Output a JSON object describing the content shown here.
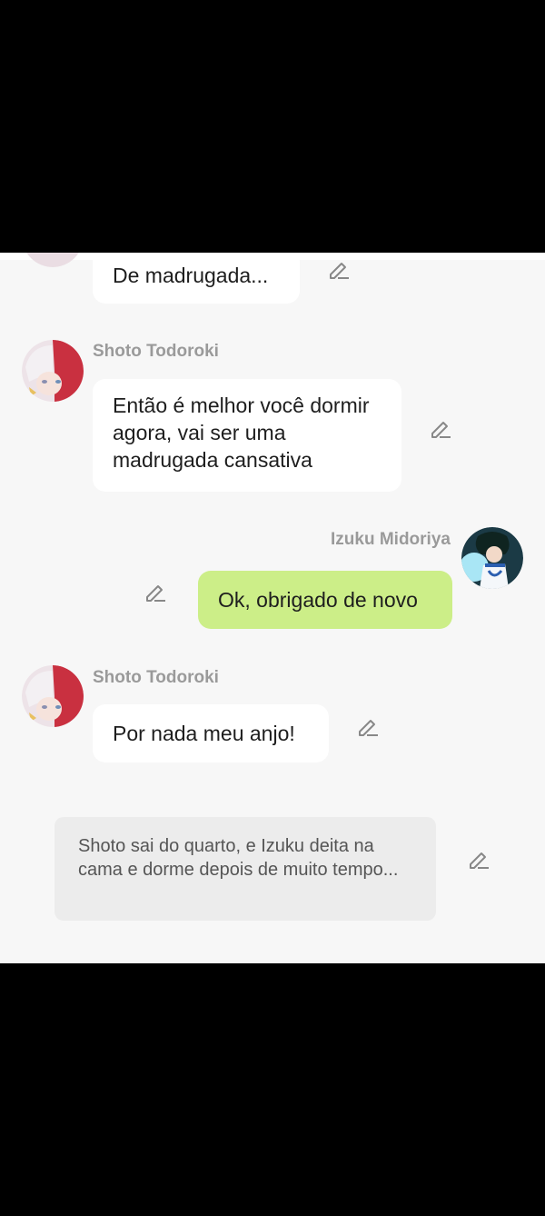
{
  "messages": [
    {
      "sender": "",
      "text": "De madrugada..."
    },
    {
      "sender": "Shoto Todoroki",
      "text": "Então é melhor você dormir agora, vai ser uma madrugada cansativa"
    },
    {
      "sender": "Izuku Midoriya",
      "text": "Ok, obrigado de novo"
    },
    {
      "sender": "Shoto Todoroki",
      "text": "Por nada meu anjo!"
    }
  ],
  "narration": {
    "text": "Shoto sai do quarto, e Izuku deita na cama e dorme depois de muito tempo..."
  },
  "icons": {
    "edit": "pencil-edit-icon",
    "avatar_shoto": "shoto-todoroki-avatar",
    "avatar_izuku": "izuku-midoriya-avatar"
  },
  "colors": {
    "chat_background": "#f7f7f7",
    "incoming_bubble": "#ffffff",
    "outgoing_bubble": "#ccee88",
    "narration_bubble": "#ececec",
    "sender_name": "#9a9a9a",
    "screen_frame": "#000000"
  }
}
